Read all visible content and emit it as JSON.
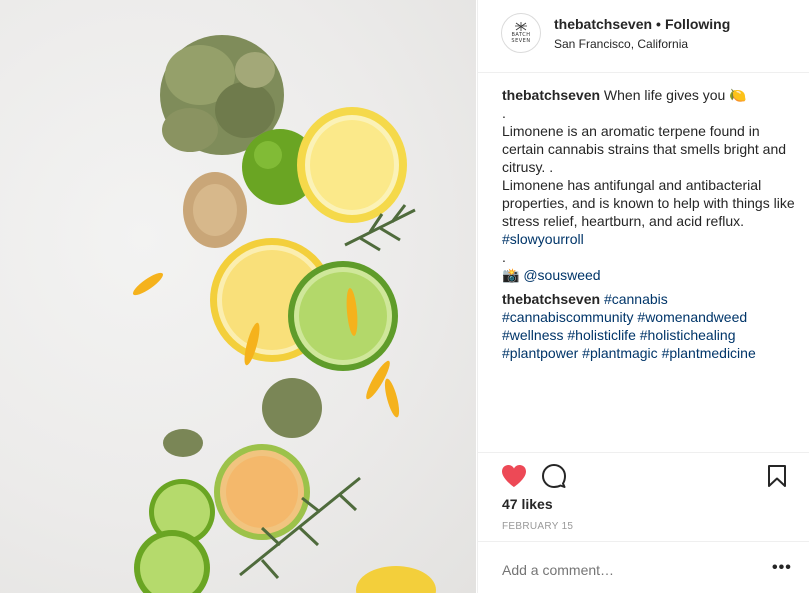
{
  "post": {
    "image_alt": "Citrus slices, cannabis buds and rosemary on white surface"
  },
  "header": {
    "avatar_line1": "BATCH",
    "avatar_line2": "SEVEN",
    "username": "thebatchseven",
    "separator": "•",
    "follow_status": "Following",
    "location": "San Francisco, California"
  },
  "caption": {
    "username": "thebatchseven",
    "line1": " When life gives you 🍋",
    "dot1": ".",
    "body1": "Limonene is an aromatic terpene found in certain cannabis strains that smells bright and citrusy. .",
    "body2": "Limonene has antifungal and antibacterial properties, and is known to help with things like stress relief, heartburn, and acid reflux. ",
    "tag_slow": "#slowyourroll",
    "dot2": ".",
    "credit_icon": "📸",
    "credit": " @sousweed"
  },
  "comment": {
    "username": "thebatchseven",
    "tags": [
      "#cannabis",
      "#cannabiscommunity",
      "#womenandweed",
      "#wellness",
      "#holisticlife",
      "#holistichealing",
      "#plantpower",
      "#plantmagic",
      "#plantmedicine"
    ]
  },
  "actions": {
    "like_color": "#ed4956"
  },
  "likes": "47 likes",
  "date": "FEBRUARY 15",
  "comment_bar": {
    "placeholder": "Add a comment…",
    "more": "•••"
  }
}
